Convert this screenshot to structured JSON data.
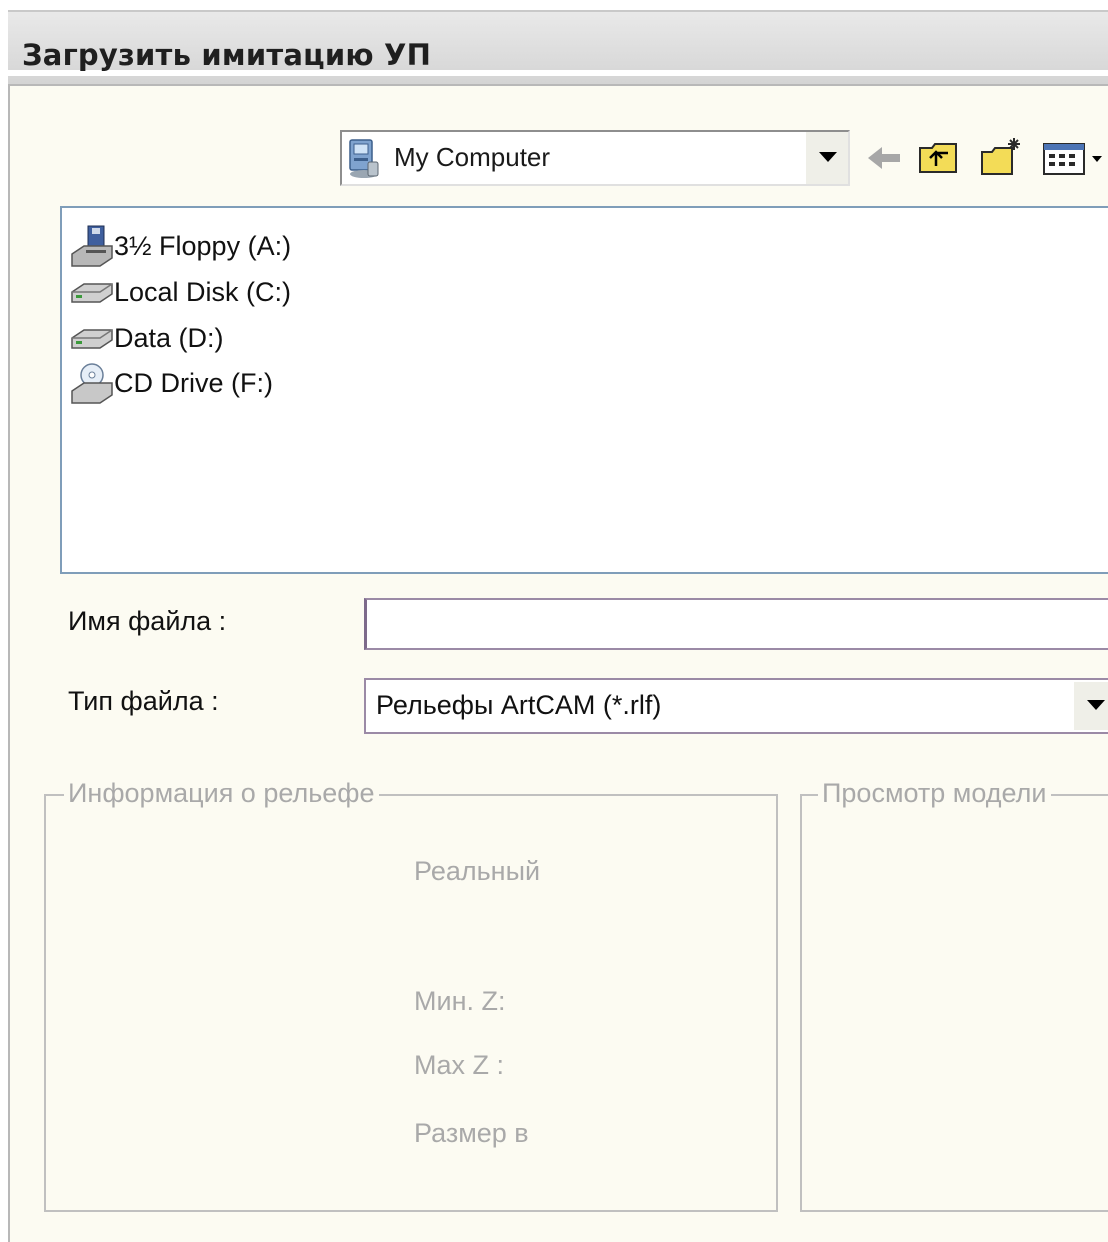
{
  "window": {
    "title": "Загрузить имитацию УП"
  },
  "toolbar": {
    "look_in_value": "My Computer",
    "look_in_icon": "my-computer-icon",
    "back_icon": "back-arrow-icon",
    "up_icon": "up-folder-icon",
    "new_folder_icon": "new-folder-icon",
    "views_icon": "views-menu-icon"
  },
  "file_list": {
    "items": [
      {
        "label": "3½ Floppy (A:)",
        "icon": "floppy-drive-icon"
      },
      {
        "label": "Local Disk (C:)",
        "icon": "hard-disk-icon"
      },
      {
        "label": "Data (D:)",
        "icon": "hard-disk-icon"
      },
      {
        "label": "CD Drive (F:)",
        "icon": "cd-drive-icon"
      }
    ]
  },
  "form": {
    "file_name_label": "Имя файла :",
    "file_name_value": "",
    "file_type_label": "Тип файла :",
    "file_type_value": "Рельефы ArtCAM (*.rlf)"
  },
  "relief_info": {
    "legend": "Информация о рельефе",
    "real_label": "Реальный",
    "min_z_label": "Мин. Z:",
    "max_z_label": "Max Z :",
    "size_label": "Размер в"
  },
  "preview": {
    "legend": "Просмотр модели"
  },
  "colors": {
    "dialog_bg": "#fcfbf2",
    "list_border": "#7f9db9",
    "disabled_text": "#a9a9a9"
  }
}
